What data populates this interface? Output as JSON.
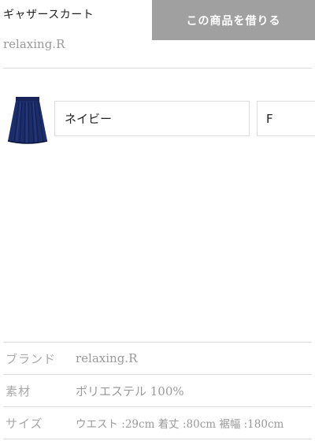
{
  "product": {
    "title": "ギャザースカート",
    "brand": "relaxing.R",
    "rent_button_label": "この商品を借りる"
  },
  "variant": {
    "color_value": "ネイビー",
    "size_value": "F",
    "thumbnail": "navy-gathered-skirt"
  },
  "specs": [
    {
      "label": "ブランド",
      "value": "relaxing.R"
    },
    {
      "label": "素材",
      "value": "ポリエステル 100%"
    },
    {
      "label": "サイズ",
      "value": "ウエスト :29cm 着丈 :80cm 裾幅 :180cm"
    }
  ],
  "colors": {
    "button_bg": "#a0a0a0",
    "skirt_navy": "#1c2d6b",
    "divider": "#dcdcdc"
  }
}
